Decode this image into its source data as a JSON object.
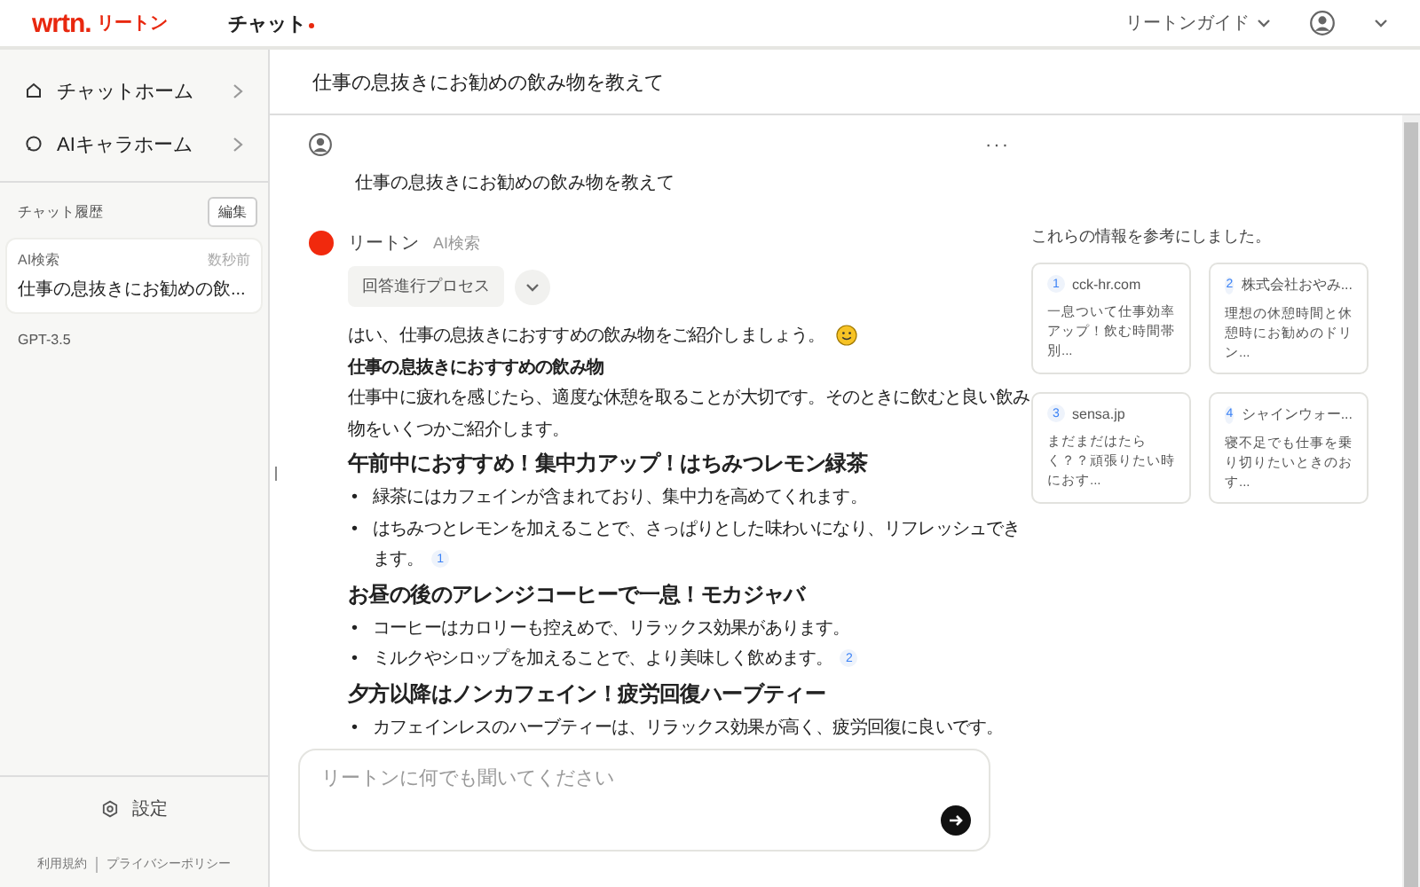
{
  "header": {
    "logo": "wrtn.",
    "logo_sub": "リートン",
    "app_title": "チャット",
    "guide": "リートンガイド"
  },
  "sidebar": {
    "nav": [
      {
        "label": "チャットホーム"
      },
      {
        "label": "AIキャラホーム"
      }
    ],
    "history_title": "チャット履歴",
    "edit": "編集",
    "history": [
      {
        "kind": "card",
        "tag": "AI検索",
        "time": "数秒前",
        "title": "仕事の息抜きにお勧めの飲...",
        "selected": true
      },
      {
        "kind": "plain",
        "tag": "GPT-3.5",
        "selected": false
      }
    ],
    "settings": "設定",
    "footer_links": [
      "利用規約",
      "プライバシーポリシー"
    ]
  },
  "chat": {
    "title": "仕事の息抜きにお勧めの飲み物を教えて",
    "more": "···",
    "user_message": "仕事の息抜きにお勧めの飲み物を教えて",
    "bot_name": "リートン",
    "bot_mode": "AI検索",
    "process_button": "回答進行プロセス",
    "answer": [
      {
        "kind": "p",
        "text": "はい、仕事の息抜きにおすすめの飲み物をご紹介しましょう。",
        "emoji": true
      },
      {
        "kind": "strong",
        "text": "仕事の息抜きにおすすめの飲み物"
      },
      {
        "kind": "p",
        "text": "仕事中に疲れを感じたら、適度な休憩を取ることが大切です。そのときに飲むと良い飲み物をいくつかご紹介します。"
      },
      {
        "kind": "h",
        "text": "午前中におすすめ！集中力アップ！はちみつレモン緑茶"
      },
      {
        "kind": "li",
        "marker": "•",
        "text": "緑茶にはカフェインが含まれており、集中力を高めてくれます。"
      },
      {
        "kind": "li",
        "marker": "•",
        "text": "はちみつとレモンを加えることで、さっぱりとした味わいになり、リフレッシュできます。",
        "ref": "1"
      },
      {
        "kind": "h",
        "text": "お昼の後のアレンジコーヒーで一息！モカジャバ"
      },
      {
        "kind": "li",
        "marker": "•",
        "text": "コーヒーはカロリーも控えめで、リラックス効果があります。"
      },
      {
        "kind": "li",
        "marker": "•",
        "text": "ミルクやシロップを加えることで、より美味しく飲めます。",
        "ref": "2"
      },
      {
        "kind": "h",
        "text": "夕方以降はノンカフェイン！疲労回復ハーブティー"
      },
      {
        "kind": "li",
        "marker": "•",
        "text": "カフェインレスのハーブティーは、リラックス効果が高く、疲労回復に良いです。"
      }
    ],
    "sources_title": "これらの情報を参考にしました。",
    "sources": [
      {
        "num": "1",
        "site": "cck-hr.com",
        "snippet": "一息ついて仕事効率アップ！飲む時間帯別..."
      },
      {
        "num": "2",
        "site": "株式会社おやみ...",
        "snippet": "理想の休憩時間と休憩時にお勧めのドリン..."
      },
      {
        "num": "3",
        "site": "sensa.jp",
        "snippet": "まだまだはたらく？？頑張りたい時におす..."
      },
      {
        "num": "4",
        "site": "シャインウォー...",
        "snippet": "寝不足でも仕事を乗り切りたいときのおす..."
      }
    ],
    "input": {
      "placeholder": "リートンに何でも聞いてください"
    }
  }
}
